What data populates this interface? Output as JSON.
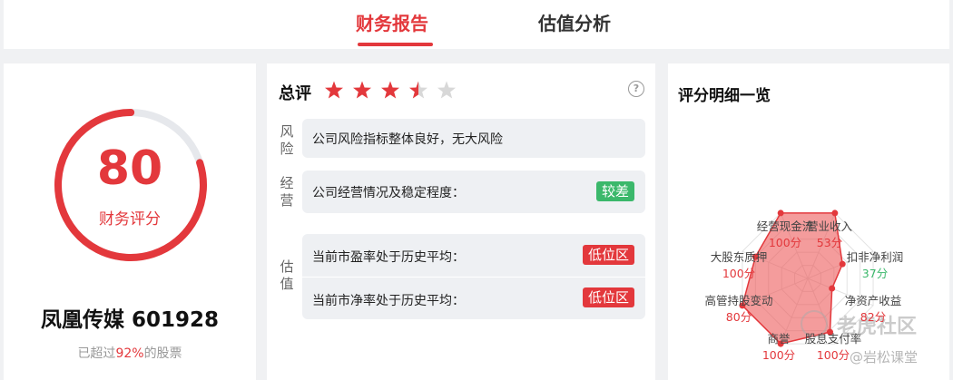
{
  "tabs": [
    {
      "label": "财务报告",
      "active": true
    },
    {
      "label": "估值分析",
      "active": false
    }
  ],
  "score_card": {
    "score": "80",
    "score_label": "财务评分",
    "score_fraction": 0.8,
    "company": "凤凰传媒 601928",
    "percentile_prefix": "已超过",
    "percentile_value": "92%",
    "percentile_suffix": "的股票"
  },
  "summary": {
    "title": "总评",
    "stars_rating": 3.5,
    "stars_total": 5,
    "help_icon": "question-circle-icon",
    "sections": {
      "risk": {
        "label_1": "风",
        "label_2": "险",
        "text": "公司风险指标整体良好，无大风险"
      },
      "operation": {
        "label_1": "经",
        "label_2": "营",
        "text": "公司经营情况及稳定程度：",
        "badge": "较差"
      },
      "valuation": {
        "label_1": "估",
        "label_2": "值",
        "rows": [
          {
            "text": "当前市盈率处于历史平均：",
            "badge": "低位区"
          },
          {
            "text": "当前市净率处于历史平均：",
            "badge": "低位区"
          }
        ]
      }
    }
  },
  "radar": {
    "title": "评分明细一览",
    "axes": [
      {
        "label": "经营现金流",
        "value_text": "100分",
        "value": 100,
        "color": "red"
      },
      {
        "label": "营业收入",
        "value_text": "53分",
        "value": 53,
        "color": "red"
      },
      {
        "label": "扣非净利润",
        "value_text": "37分",
        "value": 37,
        "color": "green"
      },
      {
        "label": "净资产收益",
        "value_text": "82分",
        "value": 82,
        "color": "red"
      },
      {
        "label": "股息支付率",
        "value_text": "100分",
        "value": 100,
        "color": "red"
      },
      {
        "label": "商誉",
        "value_text": "100分",
        "value": 100,
        "color": "red"
      },
      {
        "label": "高管持股变动",
        "value_text": "80分",
        "value": 80,
        "color": "red"
      },
      {
        "label": "大股东质押",
        "value_text": "100分",
        "value": 100,
        "color": "red"
      }
    ],
    "watermark_1": "老虎社区",
    "watermark_2": "@岩松课堂"
  },
  "colors": {
    "accent": "#e3383c",
    "good": "#3bb86b",
    "panel": "#eef0f3"
  }
}
